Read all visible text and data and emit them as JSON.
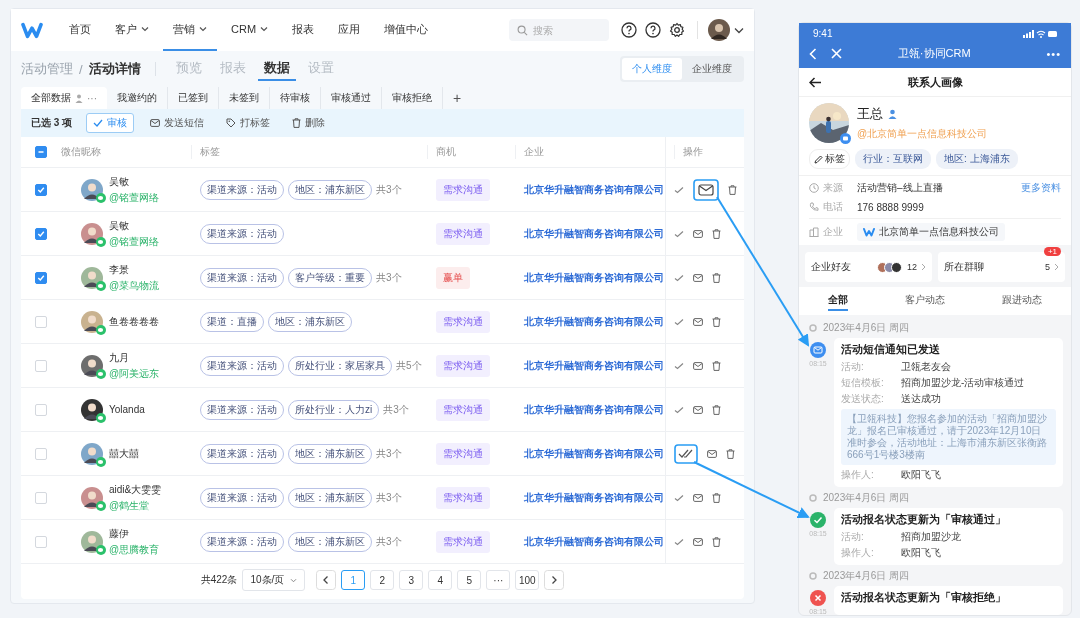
{
  "nav": {
    "items": [
      {
        "label": "首页",
        "dropdown": false,
        "selected": false
      },
      {
        "label": "客户",
        "dropdown": true,
        "selected": false
      },
      {
        "label": "营销",
        "dropdown": true,
        "selected": true
      },
      {
        "label": "CRM",
        "dropdown": true,
        "selected": false
      },
      {
        "label": "报表",
        "dropdown": false,
        "selected": false
      },
      {
        "label": "应用",
        "dropdown": false,
        "selected": false
      },
      {
        "label": "增值中心",
        "dropdown": false,
        "selected": false
      }
    ],
    "search": {
      "placeholder": "搜索"
    }
  },
  "breadcrumb": {
    "parent": "活动管理",
    "separator": "/",
    "current": "活动详情"
  },
  "page_tabs": [
    {
      "label": "预览",
      "selected": false
    },
    {
      "label": "报表",
      "selected": false
    },
    {
      "label": "数据",
      "selected": true
    },
    {
      "label": "设置",
      "selected": false
    }
  ],
  "dimension_toggle": [
    {
      "label": "个人维度",
      "selected": true
    },
    {
      "label": "企业维度",
      "selected": false
    }
  ],
  "filter_tabs": [
    {
      "label": "全部数据",
      "selected": true,
      "more": "···"
    },
    {
      "label": "我邀约的",
      "selected": false
    },
    {
      "label": "已签到",
      "selected": false
    },
    {
      "label": "未签到",
      "selected": false
    },
    {
      "label": "待审核",
      "selected": false
    },
    {
      "label": "审核通过",
      "selected": false
    },
    {
      "label": "审核拒绝",
      "selected": false
    }
  ],
  "add_tab": "+",
  "bulk_bar": {
    "count_text": "已选 3 项",
    "actions": [
      {
        "kind": "approve",
        "label": "审核"
      },
      {
        "kind": "sms",
        "label": "发送短信"
      },
      {
        "kind": "tag",
        "label": "打标签"
      },
      {
        "kind": "delete",
        "label": "删除"
      }
    ]
  },
  "table": {
    "header_indeterminate": true,
    "columns": [
      "微信昵称",
      "标签",
      "商机",
      "企业",
      "操作"
    ],
    "rows": [
      {
        "checked": true,
        "name": "吴敏",
        "org": "@铭萱网络",
        "tags": [
          "渠道来源：活动",
          "地区：浦东新区"
        ],
        "tag_count": "共3个",
        "opportunity": {
          "text": "需求沟通",
          "kind": "demand"
        },
        "company": "北京华升融智商务咨询有限公司",
        "mail_highlighted": true,
        "approve_highlighted": false
      },
      {
        "checked": true,
        "name": "吴敏",
        "org": "@铭萱网络",
        "tags": [
          "渠道来源：活动"
        ],
        "opportunity": {
          "text": "需求沟通",
          "kind": "demand"
        },
        "company": "北京华升融智商务咨询有限公司",
        "mail_highlighted": false,
        "approve_highlighted": false
      },
      {
        "checked": true,
        "name": "李景",
        "org": "@菜鸟物流",
        "tags": [
          "渠道来源：活动",
          "客户等级：重要"
        ],
        "tag_count": "共3个",
        "opportunity": {
          "text": "赢单",
          "kind": "won"
        },
        "company": "北京华升融智商务咨询有限公司",
        "mail_highlighted": false,
        "approve_highlighted": false
      },
      {
        "checked": false,
        "name": "鱼卷卷卷卷",
        "tags": [
          "渠道：直播",
          "地区：浦东新区"
        ],
        "opportunity": {
          "text": "需求沟通",
          "kind": "demand"
        },
        "company": "北京华升融智商务咨询有限公司",
        "mail_highlighted": false,
        "approve_highlighted": false
      },
      {
        "checked": false,
        "name": "九月",
        "org": "@阿美远东",
        "tags": [
          "渠道来源：活动",
          "所处行业：家居家具"
        ],
        "tag_count": "共5个",
        "opportunity": {
          "text": "需求沟通",
          "kind": "demand"
        },
        "company": "北京华升融智商务咨询有限公司",
        "mail_highlighted": false,
        "approve_highlighted": false
      },
      {
        "checked": false,
        "name": "Yolanda",
        "tags": [
          "渠道来源：活动",
          "所处行业：人力zi"
        ],
        "tag_count": "共3个",
        "opportunity": {
          "text": "需求沟通",
          "kind": "demand"
        },
        "company": "北京华升融智商务咨询有限公司",
        "mail_highlighted": false,
        "approve_highlighted": false
      },
      {
        "checked": false,
        "name": "囍大囍",
        "tags": [
          "渠道来源：活动",
          "地区：浦东新区"
        ],
        "tag_count": "共3个",
        "opportunity": {
          "text": "需求沟通",
          "kind": "demand"
        },
        "company": "北京华升融智商务咨询有限公司",
        "mail_highlighted": false,
        "approve_highlighted": true
      },
      {
        "checked": false,
        "name": "aidi&大雯雯",
        "org": "@鹤生堂",
        "tags": [
          "渠道来源：活动",
          "地区：浦东新区"
        ],
        "tag_count": "共3个",
        "opportunity": {
          "text": "需求沟通",
          "kind": "demand"
        },
        "company": "北京华升融智商务咨询有限公司",
        "mail_highlighted": false,
        "approve_highlighted": false
      },
      {
        "checked": false,
        "name": "藤伊",
        "org": "@思腾教育",
        "tags": [
          "渠道来源：活动",
          "地区：浦东新区"
        ],
        "tag_count": "共3个",
        "opportunity": {
          "text": "需求沟通",
          "kind": "demand"
        },
        "company": "北京华升融智商务咨询有限公司",
        "mail_highlighted": false,
        "approve_highlighted": false
      }
    ]
  },
  "pagination": {
    "total": "共422条",
    "page_size": "10条/页",
    "pages": [
      {
        "label": "1",
        "selected": true
      },
      {
        "label": "2",
        "selected": false
      },
      {
        "label": "3",
        "selected": false
      },
      {
        "label": "4",
        "selected": false
      },
      {
        "label": "5",
        "selected": false
      },
      {
        "label": "···",
        "selected": false
      },
      {
        "label": "100",
        "selected": false
      }
    ]
  },
  "phone": {
    "status_time": "9:41",
    "app_title": "卫瓴·协同CRM",
    "menu": "•••",
    "page_title": "联系人画像",
    "contact": {
      "name": "王总",
      "company": "@北京简单一点信息科技公司"
    },
    "tags_label": "标签",
    "tags": [
      "行业：互联网",
      "地区: 上海浦东"
    ],
    "info": [
      {
        "kind": "source",
        "label": "来源",
        "value": "活动营销–线上直播",
        "link": "更多资料"
      },
      {
        "kind": "phone",
        "label": "电话",
        "value": "176 8888 9999"
      },
      {
        "kind": "company",
        "label": "企业",
        "value": "北京简单一点信息科技公司"
      }
    ],
    "summary": [
      {
        "kind": "friends",
        "label": "企业好友",
        "count": "12"
      },
      {
        "kind": "groups",
        "label": "所在群聊",
        "count": "5",
        "badge": "+1"
      }
    ],
    "tabs": [
      {
        "label": "全部",
        "selected": true
      },
      {
        "label": "客户动态",
        "selected": false
      },
      {
        "label": "跟进动态",
        "selected": false
      }
    ],
    "timeline": [
      {
        "date": "2023年4月6日 周四",
        "kind": "sms",
        "time": "08:15",
        "title": "活动短信通知已发送",
        "fields": [
          {
            "label": "活动:",
            "value": "卫瓴老友会"
          },
          {
            "label": "短信模板:",
            "value": "招商加盟沙龙-活动审核通过"
          },
          {
            "label": "发送状态:",
            "value": "送达成功"
          }
        ],
        "message": "【卫瓴科技】您报名参加的活动「招商加盟沙龙」报名已审核通过，请于2023年12月10日准时参会，活动地址：上海市浦东新区张衡路666号1号楼3楼南",
        "after_fields": [
          {
            "label": "操作人:",
            "value": "欧阳飞飞"
          }
        ]
      },
      {
        "date": "2023年4月6日 周四",
        "kind": "approved",
        "time": "08:15",
        "title": "活动报名状态更新为「审核通过」",
        "fields": [
          {
            "label": "活动:",
            "value": "招商加盟沙龙"
          },
          {
            "label": "操作人:",
            "value": "欧阳飞飞"
          }
        ]
      },
      {
        "date": "2023年4月6日 周四",
        "kind": "rejected",
        "time": "08:15",
        "title": "活动报名状态更新为「审核拒绝」"
      }
    ]
  }
}
